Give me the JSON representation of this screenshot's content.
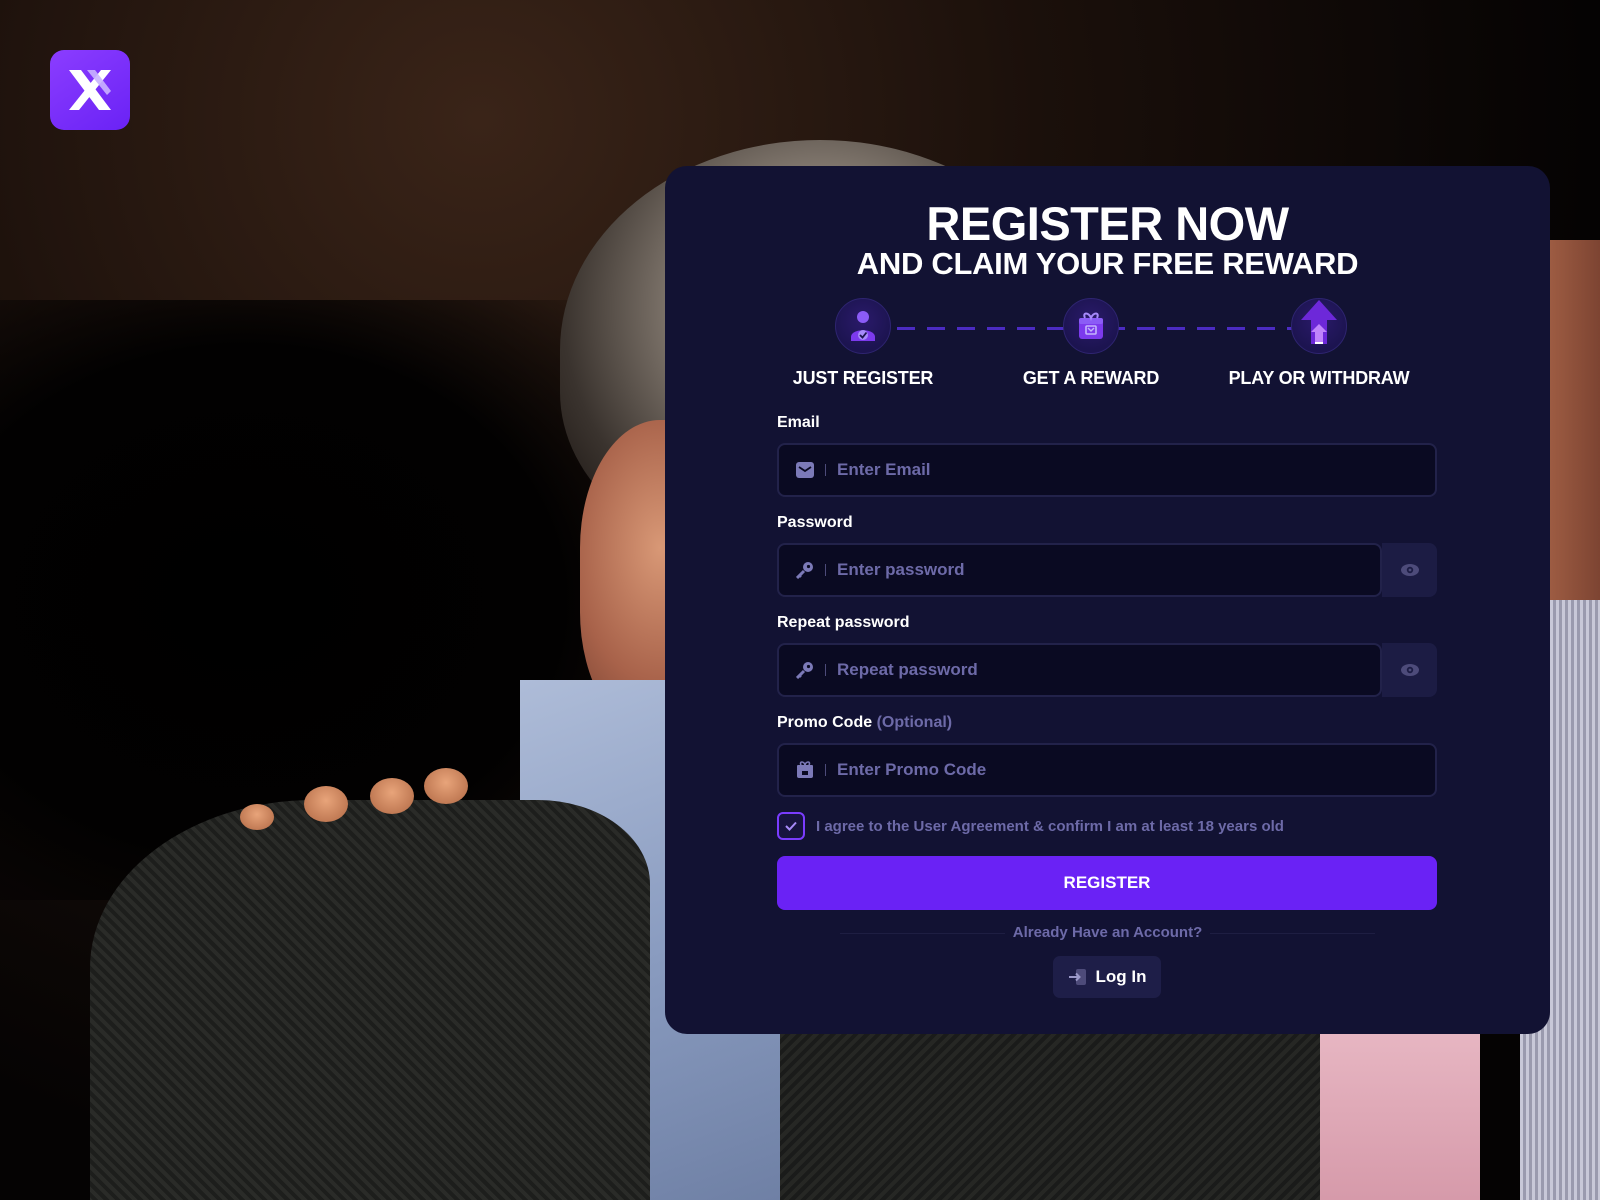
{
  "hero": {
    "title": "REGISTER NOW",
    "subtitle": "AND CLAIM YOUR FREE REWARD"
  },
  "steps": [
    {
      "label": "JUST REGISTER",
      "icon": "user-check-icon"
    },
    {
      "label": "GET A REWARD",
      "icon": "gift-icon"
    },
    {
      "label": "PLAY OR WITHDRAW",
      "icon": "arrow-up-icon"
    }
  ],
  "form": {
    "email": {
      "label": "Email",
      "placeholder": "Enter Email",
      "value": "",
      "icon": "mail-icon"
    },
    "password": {
      "label": "Password",
      "placeholder": "Enter password",
      "value": "",
      "icon": "key-icon"
    },
    "repeat_password": {
      "label": "Repeat password",
      "placeholder": "Repeat password",
      "value": "",
      "icon": "key-icon"
    },
    "promo": {
      "label": "Promo Code",
      "optional": "(Optional)",
      "placeholder": "Enter Promo Code",
      "value": "",
      "icon": "gift-icon"
    },
    "agreement": {
      "text": "I agree to the User Agreement & confirm I am at least 18 years old",
      "checked": true
    },
    "register_label": "REGISTER"
  },
  "login": {
    "prompt": "Already Have an Account?",
    "button_label": "Log In"
  },
  "colors": {
    "accent": "#6a22f5",
    "card": "#121233",
    "input_bg": "#0a0a22",
    "muted_text": "#6d6aa8"
  }
}
